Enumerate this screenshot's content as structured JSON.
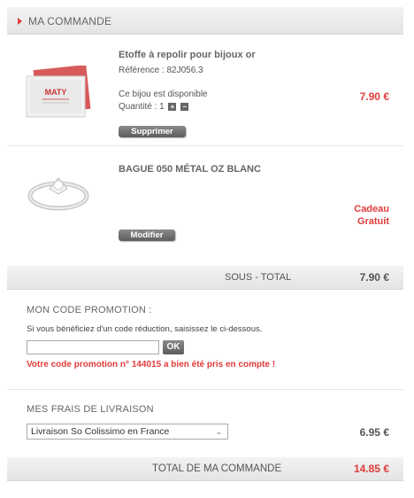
{
  "header": {
    "title": "MA COMMANDE"
  },
  "items": [
    {
      "name": "Etoffe à repolir pour bijoux or",
      "reference": "Référence : 82J056.3",
      "availability": "Ce bijou est disponible",
      "quantity_label": "Quantité : 1",
      "plus_icon": "+",
      "minus_icon": "−",
      "price": "7.90 €",
      "action_label": "Supprimer",
      "image_logo": "MATY"
    },
    {
      "name": "BAGUE 050 MÉTAL OZ BLANC",
      "price_line1": "Cadeau",
      "price_line2": "Gratuit",
      "action_label": "Modifier"
    }
  ],
  "subtotal": {
    "label": "SOUS - TOTAL",
    "amount": "7.90 €"
  },
  "promo": {
    "title": "MON CODE PROMOTION :",
    "instructions": "Si vous bénéficiez d'un code réduction, saisissez le ci-dessous.",
    "input_value": "",
    "ok_label": "OK",
    "confirmation": "Votre code promotion n° 144015 a bien été pris en compte !"
  },
  "shipping": {
    "title": "MES FRAIS DE LIVRAISON",
    "selected_option": "Livraison So Colissimo en France",
    "amount": "6.95 €"
  },
  "total": {
    "label": "TOTAL DE MA COMMANDE",
    "amount": "14.85 €"
  },
  "colors": {
    "accent": "#e23b3b",
    "bar": "#e8e8e8",
    "button": "#6b6b6b"
  }
}
